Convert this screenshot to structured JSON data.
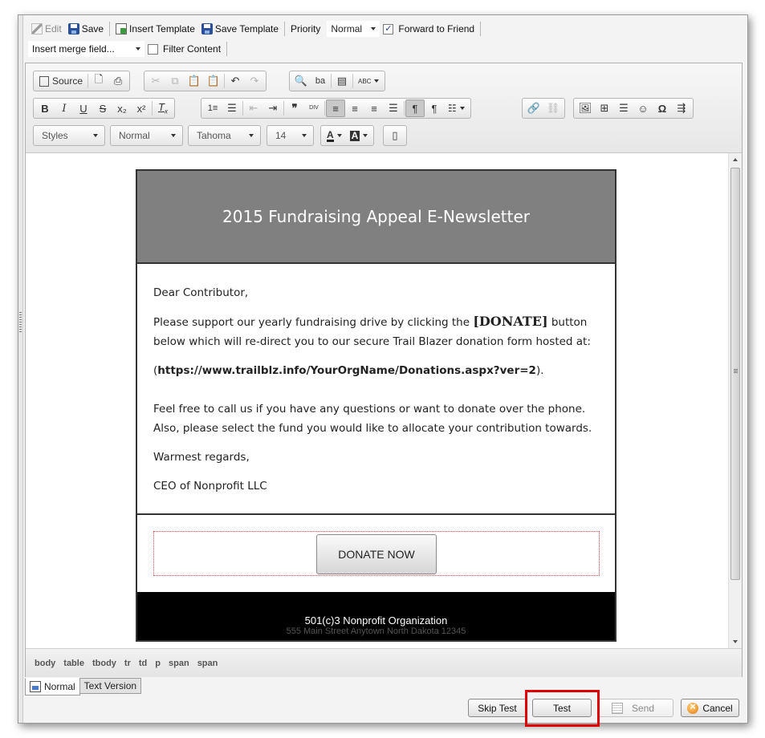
{
  "topbar": {
    "edit": "Edit",
    "save": "Save",
    "insert_template": "Insert Template",
    "save_template": "Save Template",
    "priority_label": "Priority",
    "priority_value": "Normal",
    "forward_label": "Forward to Friend",
    "forward_checked": "✓",
    "merge_field": "Insert merge field...",
    "filter_label": "Filter Content"
  },
  "toolbar": {
    "source_label": "Source",
    "styles": "Styles",
    "format": "Normal",
    "font": "Tahoma",
    "size": "14",
    "spell_label": "ABC"
  },
  "newsletter": {
    "title": "2015 Fundraising Appeal E-Newsletter",
    "greeting": "Dear Contributor,",
    "para1_a": "Please support our yearly fundraising drive by clicking the ",
    "para1_donate": "[DONATE]",
    "para1_b": " button below which will re-direct you to our secure Trail Blazer donation form hosted at:",
    "url_open": "(",
    "url": "https://www.trailblz.info/YourOrgName/Donations.aspx?ver=2",
    "url_close": ").",
    "para2": "Feel free to call us if you have any questions or want to donate over the phone. Also, please select the fund you would like to allocate your contribution towards.",
    "closing": "Warmest regards,",
    "signature": "CEO of Nonprofit LLC",
    "donate_button": "DONATE NOW",
    "footer_line1": "501(c)3 Nonprofit Organization",
    "footer_line2_cut": "555 Main Street Anytown North Dakota 12345"
  },
  "pathbar": [
    "body",
    "table",
    "tbody",
    "tr",
    "td",
    "p",
    "span",
    "span"
  ],
  "tabs": {
    "normal": "Normal",
    "text": "Text Version"
  },
  "buttons": {
    "skip_test": "Skip Test",
    "test": "Test",
    "send": "Send",
    "cancel": "Cancel"
  }
}
